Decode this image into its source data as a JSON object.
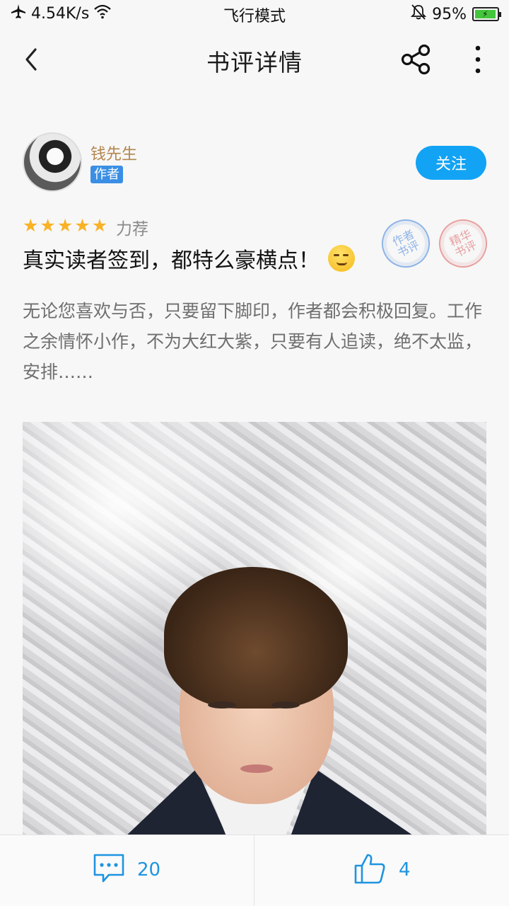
{
  "status_bar": {
    "speed": "4.54K/s",
    "mode": "飞行模式",
    "battery": "95%",
    "colors": {
      "battery_fill": "#43c53c"
    }
  },
  "nav": {
    "title": "书评详情",
    "icons": [
      "back-arrow-icon",
      "share-icon",
      "more-vertical-icon"
    ]
  },
  "author": {
    "name": "钱先生",
    "badge": "作者",
    "follow_label": "关注",
    "colors": {
      "name": "#b3864f",
      "badge": "#3a8fe4",
      "follow": "#13a3f4"
    }
  },
  "rating": {
    "stars": 5,
    "max_stars": 5,
    "label": "力荐",
    "colors": {
      "star": "#f9b225"
    }
  },
  "stamps": [
    {
      "text": "作者书评"
    },
    {
      "text": "精华书评"
    }
  ],
  "review": {
    "title": "真实读者签到，都特么豪横点！",
    "emoji": "smirk-emoji",
    "body": "无论您喜欢与否，只要留下脚印，作者都会积极回复。工作之余情怀小作，不为大红大紫，只要有人追读，绝不太监，安排……"
  },
  "bottom_bar": {
    "comment_count": "20",
    "like_count": "4",
    "colors": {
      "accent": "#1e94e0"
    }
  }
}
